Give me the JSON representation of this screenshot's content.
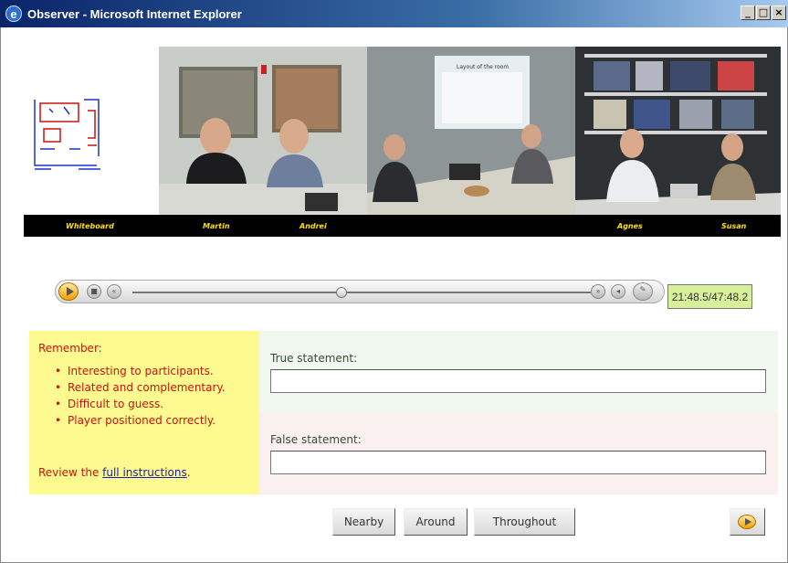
{
  "window": {
    "title": "Observer - Microsoft Internet Explorer",
    "minimize": "_",
    "maximize": "□",
    "close": "×"
  },
  "video": {
    "labels": {
      "whiteboard": "Whiteboard",
      "martin": "Martin",
      "andrei": "Andrei",
      "agnes": "Agnes",
      "susan": "Susan"
    },
    "screen_text": "Layout of the room"
  },
  "player": {
    "time": "21:48.5/47:48.2",
    "position_fraction": 0.455
  },
  "reminder": {
    "heading": "Remember:",
    "items": [
      "Interesting to participants.",
      "Related and complementary.",
      "Difficult to guess.",
      "Player positioned correctly."
    ],
    "review_prefix": "Review the ",
    "review_link": "full instructions",
    "review_suffix": "."
  },
  "form": {
    "true_label": "True statement:",
    "true_value": "",
    "false_label": "False statement:",
    "false_value": ""
  },
  "buttons": {
    "nearby": "Nearby",
    "around": "Around",
    "throughout": "Throughout"
  }
}
